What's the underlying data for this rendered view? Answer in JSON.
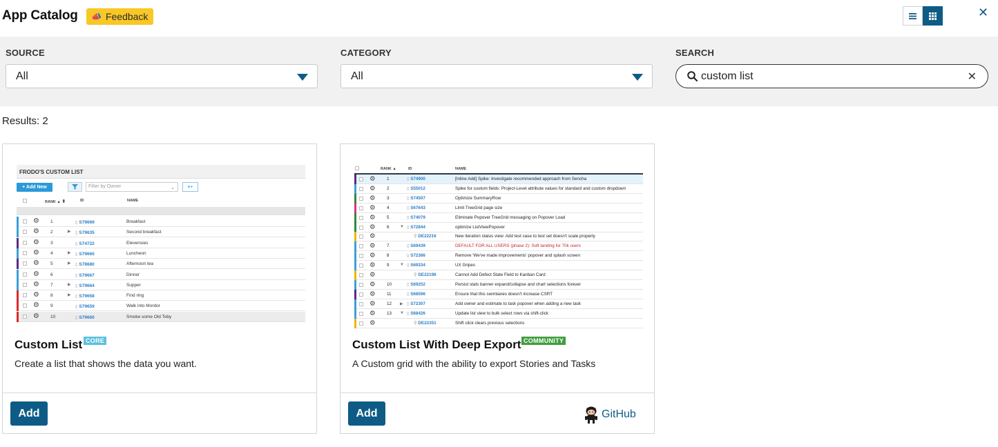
{
  "header": {
    "title": "App Catalog",
    "feedback_label": "Feedback",
    "feedback_icon": "megaphone-icon",
    "list_view_icon": "list-view-icon",
    "grid_view_icon": "grid-view-icon",
    "close_icon": "close-icon"
  },
  "filters": {
    "source": {
      "label": "SOURCE",
      "value": "All"
    },
    "category": {
      "label": "CATEGORY",
      "value": "All"
    },
    "search": {
      "label": "SEARCH",
      "value": "custom list"
    }
  },
  "results_text": "Results: 2",
  "colors": {
    "accent": "#0e5c86",
    "feedback": "#f9c726",
    "core_badge": "#5bc0de",
    "community_badge": "#3f9e3f"
  },
  "cards": [
    {
      "title": "Custom List",
      "badge": "CORE",
      "description": "Create a list that shows the data you want.",
      "add_label": "Add",
      "thumbnail": {
        "heading": "FRODO'S CUSTOM LIST",
        "add_new": "+ Add New",
        "filter_placeholder": "Filter by Owner",
        "col_button": "≡+",
        "col_rank": "RANK ▲",
        "col_id": "ID",
        "col_name": "NAME",
        "rows": [
          {
            "rank": "1",
            "id": "S79669",
            "name": "Breakfast",
            "expand": false,
            "color": "#3aa0d8"
          },
          {
            "rank": "2",
            "id": "S79635",
            "name": "Second breakfast",
            "expand": true,
            "color": "#3aa0d8"
          },
          {
            "rank": "3",
            "id": "S74722",
            "name": "Elevensies",
            "expand": false,
            "color": "#5a2a82"
          },
          {
            "rank": "4",
            "id": "S79665",
            "name": "Luncheon",
            "expand": true,
            "color": "#3aa0d8"
          },
          {
            "rank": "5",
            "id": "S78680",
            "name": "Afternoon tea",
            "expand": true,
            "color": "#5a2a82"
          },
          {
            "rank": "6",
            "id": "S79667",
            "name": "Dinner",
            "expand": false,
            "color": "#3aa0d8"
          },
          {
            "rank": "7",
            "id": "S79664",
            "name": "Supper",
            "expand": true,
            "color": "#3aa0d8"
          },
          {
            "rank": "8",
            "id": "S79658",
            "name": "Find ring",
            "expand": true,
            "color": "#d92b2b"
          },
          {
            "rank": "9",
            "id": "S79659",
            "name": "Walk into Mordor",
            "expand": false,
            "color": "#d92b2b"
          },
          {
            "rank": "10",
            "id": "S79660",
            "name": "Smoke some Old Toby",
            "expand": false,
            "color": "#d92b2b"
          }
        ]
      }
    },
    {
      "title": "Custom List With Deep Export",
      "badge": "COMMUNITY",
      "description": "A Custom grid with the ability to export Stories and Tasks",
      "add_label": "Add",
      "github_label": "GitHub",
      "github_icon": "octocat-icon",
      "thumbnail": {
        "col_rank": "RANK ▲",
        "col_id": "ID",
        "col_name": "NAME",
        "rows": [
          {
            "rank": "1",
            "id": "S74900",
            "name": "[Inline Add] Spike: Investigate recommended approach from Sencha",
            "color": "#5a2a82",
            "highlight": true
          },
          {
            "rank": "2",
            "id": "S55012",
            "name": "Spike for custom fields: Project-Level attribute values for standard and custom dropdown",
            "color": "#3aa0d8"
          },
          {
            "rank": "3",
            "id": "S74507",
            "name": "Optimize SummaryRow",
            "color": "#2e8b3a"
          },
          {
            "rank": "4",
            "id": "S67643",
            "name": "Limit TreeGrid page size",
            "color": "#d63384"
          },
          {
            "rank": "5",
            "id": "S74079",
            "name": "Eliminate Popover TreeGrid messaging on Popover Load",
            "color": "#2e8b3a"
          },
          {
            "rank": "6",
            "id": "S72844",
            "name": "optimize ListViewPopover",
            "color": "#2e8b3a",
            "expand": true
          },
          {
            "rank": "",
            "id": "DE22216",
            "name": "New iteration status view: Add test case to test set doesn't scale properly",
            "color": "#f0b400",
            "child": true
          },
          {
            "rank": "7",
            "id": "S69439",
            "name": "DEFAULT FOR ALL USERS (phase 2): Soft landing for 70k users",
            "color": "#3aa0d8",
            "red": true
          },
          {
            "rank": "8",
            "id": "S72386",
            "name": "Remove 'We've made improvements' popover and splash screen",
            "color": "#3aa0d8"
          },
          {
            "rank": "9",
            "id": "S69334",
            "name": "UX Gripes",
            "color": "#3aa0d8",
            "expand": true
          },
          {
            "rank": "",
            "id": "DE22196",
            "name": "Cannot Add Defect State Field to Kanban Card",
            "color": "#f0b400",
            "child": true
          },
          {
            "rank": "10",
            "id": "S69252",
            "name": "Persist stats banner expand/collapse and chart selections forever",
            "color": "#3aa0d8"
          },
          {
            "rank": "11",
            "id": "S68596",
            "name": "Ensure that this swimlanes doesn't increase CSRT",
            "color": "#5a2a82"
          },
          {
            "rank": "12",
            "id": "S72307",
            "name": "Add owner and estimate to task popover when adding a new task",
            "color": "#3aa0d8",
            "expand_right": true
          },
          {
            "rank": "13",
            "id": "S68426",
            "name": "Update list view to bulk select rows via shift-click",
            "color": "#3aa0d8",
            "expand": true
          },
          {
            "rank": "",
            "id": "DE22351",
            "name": "Shift click clears previous selections",
            "color": "#f0b400",
            "child": true
          }
        ]
      }
    }
  ]
}
